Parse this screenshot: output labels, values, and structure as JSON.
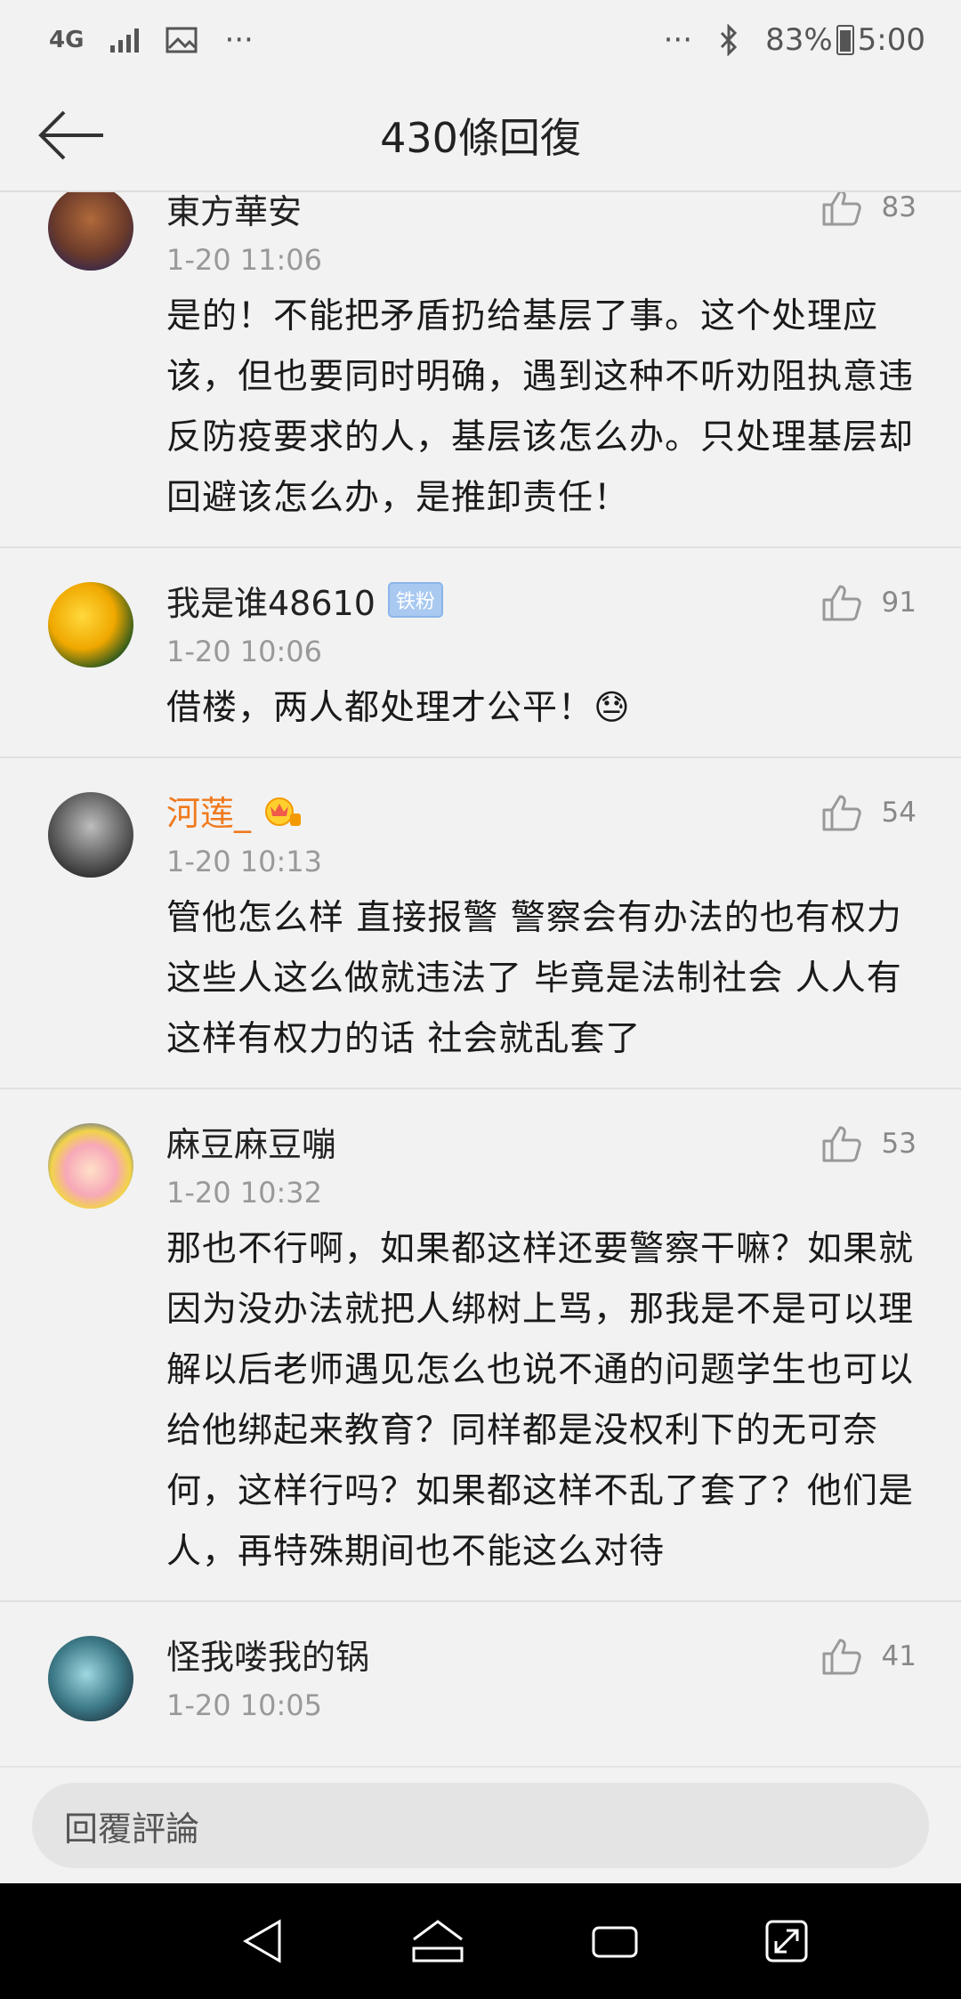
{
  "status": {
    "network": "4G",
    "more_left": "···",
    "more_right": "···",
    "battery": "83%",
    "time": "5:00"
  },
  "header": {
    "title": "430條回復"
  },
  "comments": [
    {
      "name": "東方華安",
      "time": "1-20 11:06",
      "likes": "83",
      "text": "是的！不能把矛盾扔给基层了事。这个处理应该，但也要同时明确，遇到这种不听劝阻执意违反防疫要求的人，基层该怎么办。只处理基层却回避该怎么办，是推卸责任！"
    },
    {
      "name": "我是谁48610",
      "badge": "铁粉",
      "time": "1-20 10:06",
      "likes": "91",
      "text": "借楼，两人都处理才公平！😓"
    },
    {
      "name": "河莲_",
      "time": "1-20 10:13",
      "likes": "54",
      "text": "管他怎么样 直接报警 警察会有办法的也有权力 这些人这么做就违法了 毕竟是法制社会 人人有这样有权力的话 社会就乱套了"
    },
    {
      "name": "麻豆麻豆嘣",
      "time": "1-20 10:32",
      "likes": "53",
      "text": "那也不行啊，如果都这样还要警察干嘛？如果就因为没办法就把人绑树上骂，那我是不是可以理解以后老师遇见怎么也说不通的问题学生也可以给他绑起来教育？同样都是没权利下的无可奈何，这样行吗？如果都这样不乱了套了？他们是人，再特殊期间也不能这么对待"
    },
    {
      "name": "怪我喽我的锅",
      "time": "1-20 10:05",
      "likes": "41",
      "text": ""
    }
  ],
  "reply": {
    "placeholder": "回覆評論"
  }
}
